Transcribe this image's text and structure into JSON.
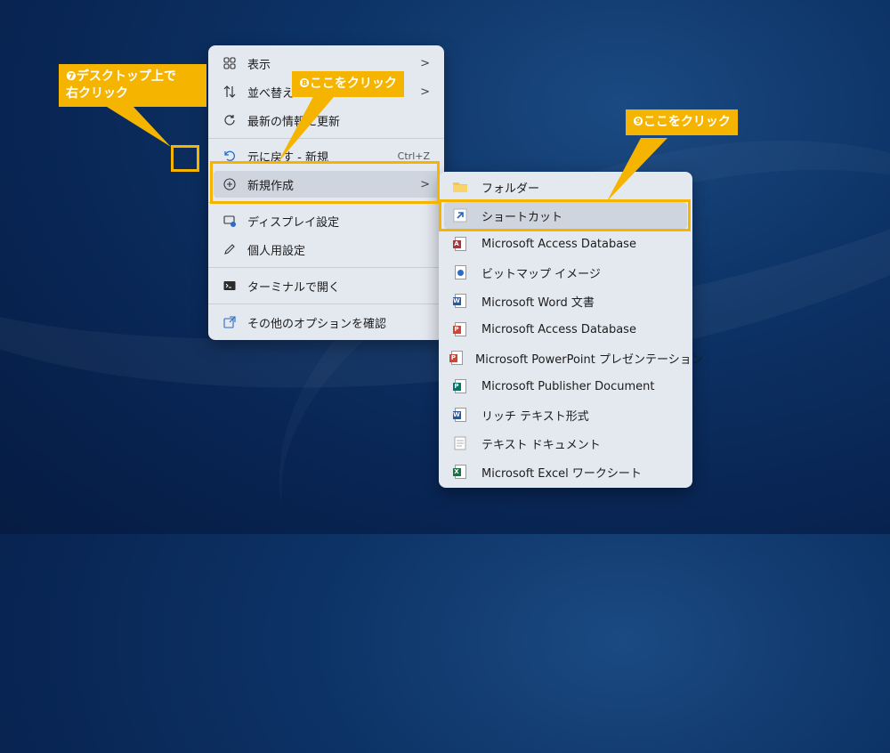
{
  "context_menu": {
    "items": [
      {
        "label": "表示",
        "icon": "view-grid-icon",
        "chevron": ">"
      },
      {
        "label": "並べ替え",
        "icon": "sort-icon",
        "chevron": ">"
      },
      {
        "label": "最新の情報に更新",
        "icon": "refresh-icon"
      },
      {
        "label": "元に戻す - 新規",
        "icon": "undo-icon",
        "shortcut": "Ctrl+Z"
      },
      {
        "label": "新規作成",
        "icon": "add-circle-icon",
        "chevron": ">"
      },
      {
        "label": "ディスプレイ設定",
        "icon": "display-settings-icon"
      },
      {
        "label": "個人用設定",
        "icon": "pen-icon"
      },
      {
        "label": "ターミナルで開く",
        "icon": "terminal-icon"
      },
      {
        "label": "その他のオプションを確認",
        "icon": "more-options-icon"
      }
    ]
  },
  "submenu": {
    "items": [
      {
        "label": "フォルダー",
        "icon": "folder-icon"
      },
      {
        "label": "ショートカット",
        "icon": "shortcut-icon"
      },
      {
        "label": "Microsoft Access Database",
        "icon": "access-icon"
      },
      {
        "label": "ビットマップ イメージ",
        "icon": "bitmap-icon"
      },
      {
        "label": "Microsoft Word 文書",
        "icon": "word-icon"
      },
      {
        "label": "Microsoft Access Database",
        "icon": "access-icon"
      },
      {
        "label": "Microsoft PowerPoint プレゼンテーション",
        "icon": "powerpoint-icon"
      },
      {
        "label": "Microsoft Publisher Document",
        "icon": "publisher-icon"
      },
      {
        "label": "リッチ テキスト形式",
        "icon": "rtf-icon"
      },
      {
        "label": "テキスト ドキュメント",
        "icon": "text-document-icon"
      },
      {
        "label": "Microsoft Excel ワークシート",
        "icon": "excel-icon"
      }
    ]
  },
  "annotations": {
    "step7_line1": "❼デスクトップ上で",
    "step7_line2": "右クリック",
    "step8": "❽ここをクリック",
    "step9": "❾ここをクリック"
  },
  "colors": {
    "highlight": "#f5b400",
    "menu_bg": "#e4e8ef",
    "desktop_bg": "#0d3366"
  }
}
